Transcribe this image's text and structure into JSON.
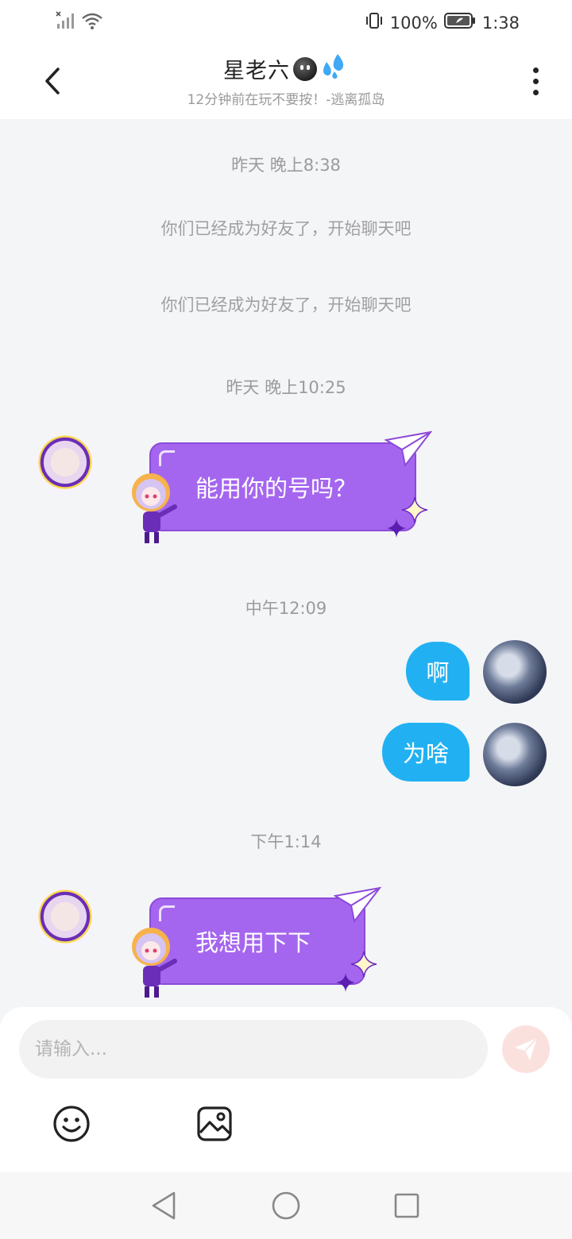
{
  "status_bar": {
    "battery_percent": "100%",
    "time": "1:38"
  },
  "header": {
    "title": "星老六",
    "title_emojis": [
      "dark-face-emoji",
      "sweat-drops-emoji"
    ],
    "subtitle": "12分钟前在玩不要按！-逃离孤岛"
  },
  "messages": [
    {
      "kind": "timestamp",
      "text": "昨天 晚上8:38"
    },
    {
      "kind": "system",
      "text": "你们已经成为好友了，开始聊天吧"
    },
    {
      "kind": "system",
      "text": "你们已经成为好友了，开始聊天吧"
    },
    {
      "kind": "timestamp",
      "text": "昨天 晚上10:25"
    },
    {
      "kind": "incoming",
      "text": "能用你的号吗？"
    },
    {
      "kind": "timestamp",
      "text": "中午12:09"
    },
    {
      "kind": "outgoing",
      "text": "啊"
    },
    {
      "kind": "outgoing",
      "text": "为啥"
    },
    {
      "kind": "timestamp",
      "text": "下午1:14"
    },
    {
      "kind": "incoming",
      "text": "我想用下下"
    }
  ],
  "input": {
    "placeholder": "请输入..."
  },
  "colors": {
    "incoming_bubble": "#a566ef",
    "outgoing_bubble": "#21b1f2",
    "send_button": "#fbe1dd",
    "background": "#f4f5f7"
  },
  "icons": {
    "back": "chevron-left-icon",
    "more": "more-vertical-icon",
    "send": "paper-plane-icon",
    "emoji": "smiley-icon",
    "image": "image-icon",
    "nav_back": "triangle-back-icon",
    "nav_home": "circle-home-icon",
    "nav_recent": "square-recent-icon"
  }
}
